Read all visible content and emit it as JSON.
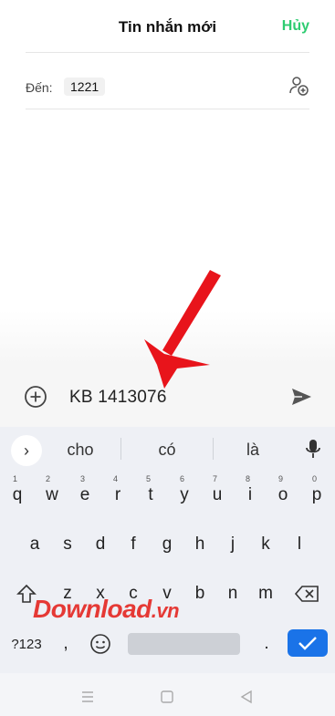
{
  "header": {
    "title": "Tin nhắn mới",
    "cancel_label": "Hủy"
  },
  "recipient": {
    "label": "Đến:",
    "number": "1221"
  },
  "composer": {
    "text": "KB 1413076"
  },
  "keyboard": {
    "suggestions": [
      "cho",
      "có",
      "là"
    ],
    "row1": [
      {
        "key": "q",
        "hint": "1"
      },
      {
        "key": "w",
        "hint": "2"
      },
      {
        "key": "e",
        "hint": "3"
      },
      {
        "key": "r",
        "hint": "4"
      },
      {
        "key": "t",
        "hint": "5"
      },
      {
        "key": "y",
        "hint": "6"
      },
      {
        "key": "u",
        "hint": "7"
      },
      {
        "key": "i",
        "hint": "8"
      },
      {
        "key": "o",
        "hint": "9"
      },
      {
        "key": "p",
        "hint": "0"
      }
    ],
    "row2": [
      "a",
      "s",
      "d",
      "f",
      "g",
      "h",
      "j",
      "k",
      "l"
    ],
    "row3": [
      "z",
      "x",
      "c",
      "v",
      "b",
      "n",
      "m"
    ],
    "symbols_label": "?123",
    "comma": ",",
    "period": "."
  },
  "watermark": {
    "brand": "Download",
    "tld": ".vn"
  },
  "colors": {
    "accent_green": "#2ecc71",
    "enter_blue": "#1a73e8",
    "arrow_red": "#e8141b"
  },
  "icons": {
    "contact_add": "add-contact-icon",
    "compose_add": "plus-circle-icon",
    "send": "send-icon",
    "mic": "microphone-icon",
    "shift": "shift-icon",
    "backspace": "backspace-icon",
    "emoji": "emoji-icon",
    "enter": "checkmark-icon"
  }
}
